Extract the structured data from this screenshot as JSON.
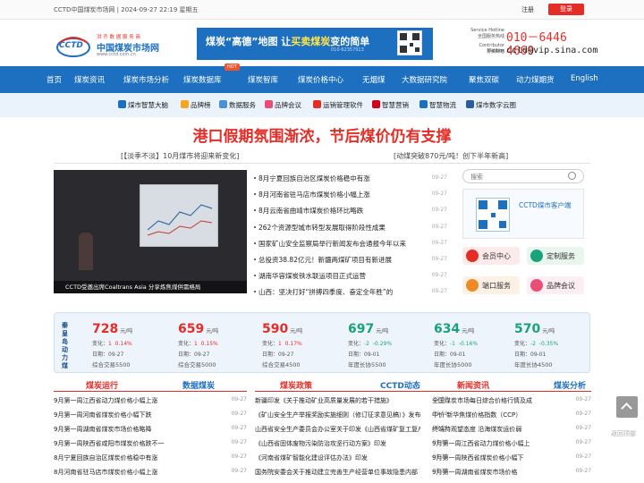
{
  "topbar": {
    "date": "CCTD中国煤炭市场网 | 2024-09-27 22:19 星期五",
    "register": "注册",
    "login": "登录"
  },
  "logo": {
    "text": "中国煤炭市场网",
    "slogan": "洪 齐 数 据 服 务 商",
    "url": "www.cctd.com.cn",
    "mark": "CCTD"
  },
  "banner": {
    "pre": "煤炭“高德”地图  让",
    "hl": "买卖煤炭",
    "post": "变的简单",
    "sub": "010-62357913"
  },
  "hotline": {
    "label1": "Service Hotline",
    "label1b": "全国服务热线",
    "phone": "010－6446 4669",
    "label2": "Contributor Mailbox",
    "label2b": "投稿邮箱",
    "email": "cctd@vip.sina.com"
  },
  "nav": {
    "hot": "HOT",
    "items": [
      "首页",
      "煤炭资讯",
      "煤炭市场分析",
      "煤炭数据库",
      "煤炭智库",
      "煤炭价格中心",
      "无烟煤",
      "大数据研究院",
      "聚焦双碳",
      "动力煤期货",
      "English"
    ]
  },
  "subnav": [
    "煤市智慧大脑",
    "品牌榜",
    "数据服务",
    "品牌会议",
    "运销管理软件",
    "智慧营销",
    "智慧物流",
    "煤市数字云图"
  ],
  "headline": "港口假期氛围渐浓，节后煤价仍有支撑",
  "subheads": [
    "[【淡季不淡】10月煤市将迎来新变化]",
    "[动煤突破870元/吨！创下半年新高]"
  ],
  "photo_caption": "CCTD受邀出席Coaltrans Asia 分享炼焦煤供需格局",
  "news": [
    {
      "t": "8月宁夏回族自治区煤炭价格稳中有涨",
      "d": "09-27"
    },
    {
      "t": "8月河南省驻马店市煤炭价格小幅上涨",
      "d": "09-27"
    },
    {
      "t": "8月云南省曲靖市煤炭价格环比略跌",
      "d": "09-27"
    },
    {
      "t": "262个资源型城市转型发展取得阶段性成果",
      "d": "09-27"
    },
    {
      "t": "国家矿山安全监察局举行新闻发布会通报今年以来",
      "d": "09-27"
    },
    {
      "t": "总投资38.82亿元！新疆两煤矿项目有新进展",
      "d": "09-27"
    },
    {
      "t": "湖南华容煤炭铁水联运项目正式运营",
      "d": "09-27"
    },
    {
      "t": "山西：坚决打好“拼搏四季度、奋定全年胜”的",
      "d": "09-27"
    }
  ],
  "search_placeholder": "搜索",
  "client_label": "CCTD煤市客户端",
  "services": [
    "会员中心",
    "定制服务",
    "端口服务",
    "品牌会议"
  ],
  "ticker_label": "秦皇岛动力煤",
  "tickers": [
    {
      "value": "728",
      "unit": "元/吨",
      "change_label": "变化：",
      "change": "1",
      "pct": "0.14%",
      "date": "日期：09-27",
      "trade": "综合交易5500",
      "color": "#e52d27"
    },
    {
      "value": "659",
      "unit": "元/吨",
      "change_label": "变化：",
      "change": "1",
      "pct": "0.15%",
      "date": "日期：09-27",
      "trade": "综合交易5000",
      "color": "#e52d27"
    },
    {
      "value": "590",
      "unit": "元/吨",
      "change_label": "变化：",
      "change": "1",
      "pct": "0.17%",
      "date": "日期：09-27",
      "trade": "综合交易4500",
      "color": "#e52d27"
    },
    {
      "value": "697",
      "unit": "元/吨",
      "change_label": "变化：",
      "change": "-2",
      "pct": "-0.29%",
      "date": "日期：09-01",
      "trade": "年度长协5500",
      "color": "#1aa37a"
    },
    {
      "value": "634",
      "unit": "元/吨",
      "change_label": "变化：",
      "change": "-1",
      "pct": "-0.16%",
      "date": "日期：09-01",
      "trade": "年度长协5000",
      "color": "#1aa37a"
    },
    {
      "value": "570",
      "unit": "元/吨",
      "change_label": "变化：",
      "change": "-2",
      "pct": "-0.35%",
      "date": "日期：09-01",
      "trade": "年度长协4500",
      "color": "#1aa37a"
    }
  ],
  "columns": [
    {
      "tab_a": "煤炭运行",
      "tab_b": "数据煤炭",
      "rows": [
        {
          "t": "9月第一周江西省动力煤价格小幅上涨",
          "d": "09-27"
        },
        {
          "t": "9月第一周河南省煤炭价格小幅下跌",
          "d": "09-27"
        },
        {
          "t": "9月第一周湖南省煤炭市场价格略降",
          "d": "09-27"
        },
        {
          "t": "9月第一周陕西省咸阳市煤炭价格跌不一",
          "d": "09-27"
        },
        {
          "t": "8月宁夏回族自治区煤炭价格稳中有涨",
          "d": "09-27"
        },
        {
          "t": "8月河南省驻马店市煤炭价格小幅上涨",
          "d": "09-27"
        }
      ]
    },
    {
      "tab_a": "煤炭政策",
      "tab_b": "CCTD动态",
      "rows": [
        {
          "t": "新疆印发《关于推动矿业高质量发展的若干措施》",
          "d": "09-27"
        },
        {
          "t": "《矿山安全生产举报奖励实施细则（修订征求意见稿）》发布",
          "d": "09-26"
        },
        {
          "t": "山西省安全生产委员会办公室关于印发《山西省煤矿复工复产验收管理办法》",
          "d": "09-24"
        },
        {
          "t": "《山西省固体废物污染防治攻坚行动方案》印发",
          "d": "09-09"
        },
        {
          "t": "《河南省煤矿智能化建设评估办法》印发",
          "d": "08-29"
        },
        {
          "t": "国务院安委会关于推动建立完善生产经营单位事故隐患内部",
          "d": "08-29"
        }
      ]
    },
    {
      "tab_a": "新闻资讯",
      "tab_b": "煤炭分析",
      "rows": [
        {
          "t": "全国煤炭市场每日综合价格行情及成",
          "d": "09-27"
        },
        {
          "t": "中价·新华焦煤价格指数（CCP）",
          "d": "09-27"
        },
        {
          "t": "终端持观望态度 沿海煤炭运价弱",
          "d": "09-27"
        },
        {
          "t": "9月第一周江西省动力煤价格小幅上",
          "d": "09-27"
        },
        {
          "t": "9月第一周陕西省煤炭价格小幅下",
          "d": "09-27"
        },
        {
          "t": "9月第一周湖南省煤炭市场价格",
          "d": "09-27"
        }
      ]
    }
  ],
  "back_to_top": "返回顶部"
}
